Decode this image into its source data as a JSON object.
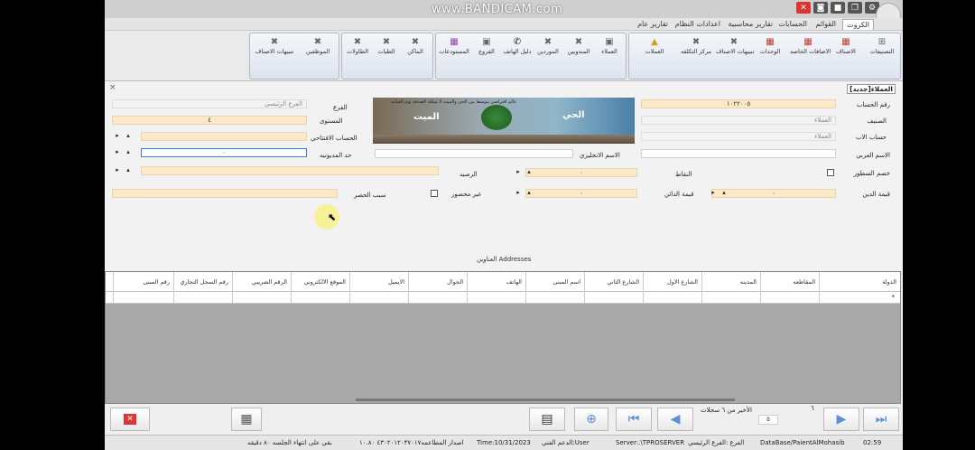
{
  "watermark": "www.BANDICAM.com",
  "menu_tabs": [
    "الكروت",
    "القوائم",
    "الحسابات",
    "تقارير محاسبية",
    "اعدادات النظام",
    "تقارير عام"
  ],
  "ribbon_groups": [
    {
      "items": [
        {
          "label": "التصنيفات",
          "icon": "sitemap-icon"
        },
        {
          "label": "الاصناف",
          "icon": "cubes-icon"
        },
        {
          "label": "الاضافات الخاصه",
          "icon": "cubes-icon"
        },
        {
          "label": "الوحدات",
          "icon": "cubes-icon"
        },
        {
          "label": "تنبيهات الاصناف",
          "icon": "tools-icon"
        },
        {
          "label": "مركز التكلفه",
          "icon": "tools-icon"
        },
        {
          "label": "العملات",
          "icon": "coins-icon"
        }
      ]
    },
    {
      "items": [
        {
          "label": "العملاء",
          "icon": "building-icon"
        },
        {
          "label": "المندوبين",
          "icon": "tools-icon"
        },
        {
          "label": "الموردين",
          "icon": "tools-icon"
        },
        {
          "label": "دليل الهاتف",
          "icon": "phone-icon"
        },
        {
          "label": "الفروع",
          "icon": "building-icon"
        },
        {
          "label": "المستودعات",
          "icon": "warehouse-icon"
        }
      ]
    },
    {
      "items": [
        {
          "label": "الماكن",
          "icon": "tools-icon"
        },
        {
          "label": "الطبات",
          "icon": "tools-icon"
        },
        {
          "label": "الطاولات",
          "icon": "tools-icon"
        }
      ]
    },
    {
      "items": [
        {
          "label": "الموظفين",
          "icon": "tools-icon"
        },
        {
          "label": "تنبيهات الاصناف",
          "icon": "tools-icon"
        }
      ]
    }
  ],
  "form": {
    "title": "العملاء[جديد]",
    "labels": {
      "account_no": "رقم الحساب",
      "category": "الصنيف",
      "parent_account": "حساب الاب",
      "arabic_name": "الاسم العربي",
      "deduct_lines": "خصم السطور",
      "debt_value": "قيمة الدين",
      "branch": "الفرع",
      "level": "المستوى",
      "opening_account": "الحساب الافتتاحي",
      "credit_limit": "حد المديونيه",
      "english_name": "الاسم الانجليزي",
      "points": "النقاط",
      "balance": "الرصيد",
      "debt_value2": "قيمة الدائن",
      "not_blocked": "غير محصور",
      "block_reason": "سبب الحصر",
      "addresses": "العناوين Addresses"
    },
    "values": {
      "account_no": "١٠٢٢٠٠٥",
      "category": "العملاء",
      "parent_account": "العملاء",
      "branch": "الفرع الرئيسي",
      "level": "٤",
      "points_val": "٠",
      "debt_val": "٠",
      "credit_val": "٠",
      "credit_limit_val": "٠"
    },
    "banner": {
      "top_text": "عالم افتراضي يتوسط بين الحي والميت لا تملكه الصدفة يوم القيامه",
      "word_alive": "الحي",
      "word_dead": "الميت"
    }
  },
  "grid": {
    "columns": [
      "الدولة",
      "المقاطعه",
      "المدينه",
      "الشارع الاول",
      "الشارع الثاني",
      "اسم المبنى",
      "الهاتف",
      "الجوال",
      "الايميل",
      "الموقع الالكتروني",
      "الرقم الضريبي",
      "رقم السجل التجاري",
      "رقم المبنى"
    ],
    "row_marker": "*"
  },
  "nav": {
    "record_info": "الأخير من ٦ سجلات",
    "record_number": "٥",
    "total": "٦"
  },
  "status": {
    "time": "02:59",
    "database": "DataBase/PaientAlMohasib",
    "branch": "الفرع :الفرع الرئيسي",
    "server": "Server:.\\TPROSERVER",
    "user": "الدعم الفني:User",
    "date": "Time:10/31/2023",
    "version": "اصدار المطاعمه٤٣٠٢٠١٢٠٣٧٠١٧ ١٠.٨٠",
    "session": "بقي على انتهاء الجلسه ٨٠ دقيقه"
  }
}
